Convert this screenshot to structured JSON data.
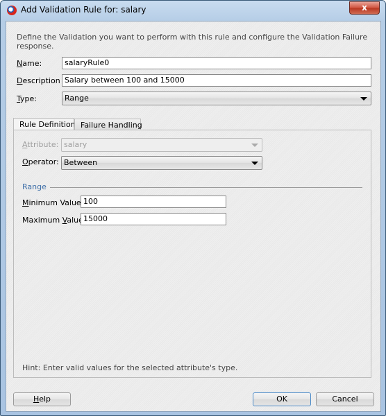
{
  "window": {
    "title": "Add Validation Rule for: salary",
    "close_label": "x"
  },
  "intro": "Define the Validation you want to perform with this rule and configure the Validation Failure response.",
  "form": {
    "name": {
      "label_prefix": "",
      "label_underline": "N",
      "label_rest": "ame:",
      "value": "salaryRule0"
    },
    "description": {
      "label_underline": "D",
      "label_rest": "escription",
      "value": "Salary between 100 and 15000"
    },
    "type": {
      "label_underline": "T",
      "label_rest": "ype:",
      "value": "Range"
    }
  },
  "tabs": [
    {
      "label": "Rule Definition",
      "active": true
    },
    {
      "label": "Failure Handling",
      "active": false
    }
  ],
  "rule_definition": {
    "attribute": {
      "label_underline": "A",
      "label_rest": "ttribute:",
      "value": "salary",
      "disabled": true
    },
    "operator": {
      "label_underline": "O",
      "label_rest": "perator:",
      "value": "Between"
    },
    "range_section": "Range",
    "minimum": {
      "label_underline": "M",
      "label_rest": "inimum Value:",
      "value": "100"
    },
    "maximum": {
      "label_prefix": "Maximum ",
      "label_underline": "V",
      "label_rest": "alue:",
      "value": "15000"
    },
    "hint": "Hint: Enter valid values for the selected attribute's type."
  },
  "buttons": {
    "help_underline": "H",
    "help_rest": "elp",
    "ok": "OK",
    "cancel": "Cancel"
  }
}
